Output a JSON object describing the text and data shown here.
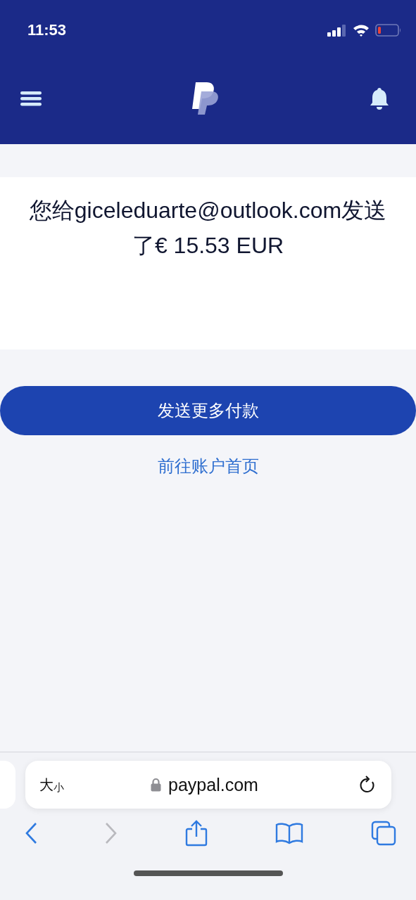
{
  "status_bar": {
    "time": "11:53"
  },
  "confirmation": {
    "message": "您给giceleduarte@outlook.com发送了€ 15.53 EUR"
  },
  "actions": {
    "primary_button": "发送更多付款",
    "link": "前往账户首页"
  },
  "browser": {
    "text_size_large": "大",
    "text_size_small": "小",
    "address": "paypal.com",
    "toolbar": [
      {
        "kind": "back",
        "disabled": false
      },
      {
        "kind": "forward",
        "disabled": true
      },
      {
        "kind": "share",
        "disabled": false
      },
      {
        "kind": "bookmarks",
        "disabled": false
      },
      {
        "kind": "tabs",
        "disabled": false
      }
    ]
  }
}
